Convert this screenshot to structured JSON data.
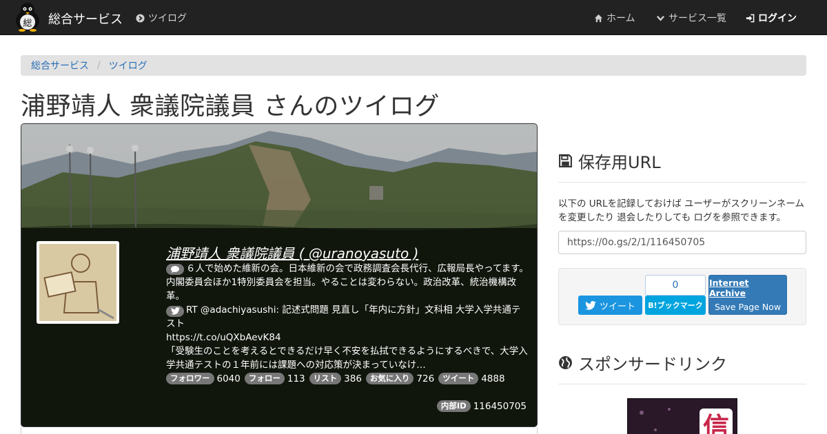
{
  "navbar": {
    "brand": "総合サービス",
    "brand_logo_char": "総",
    "service_link": "ツイログ",
    "home": "ホーム",
    "services": "サービス一覧",
    "login": "ログイン"
  },
  "breadcrumb": {
    "items": [
      "総合サービス",
      "ツイログ"
    ],
    "separator": "/"
  },
  "page_title": "浦野靖人 衆議院議員 さんのツイログ",
  "profile": {
    "display": "浦野靖人 衆議院議員 ( @uranoyasuto )",
    "bio": "６人で始めた維新の会。日本維新の会で政務調査会長代行、広報局長やってます。内閣委員会ほか1特別委員会を担当。やることは変わらない。政治改革、統治機構改革。",
    "tweet_line1": "RT @adachiyasushi: 記述式問題 見直し「年内に方針」文科相 大学入学共通テスト",
    "tweet_link": "https://t.co/uQXbAevK84",
    "tweet_line2": "「受験生のことを考えるとできるだけ早く不安を払拭できるようにするべきで、大学入学共通テストの１年前には課題への対応策が決まっていなけ…",
    "stats": [
      {
        "label": "フォロワー",
        "value": "6040"
      },
      {
        "label": "フォロー",
        "value": "113"
      },
      {
        "label": "リスト",
        "value": "386"
      },
      {
        "label": "お気に入り",
        "value": "726"
      },
      {
        "label": "ツイート",
        "value": "4888"
      }
    ],
    "internal_id_label": "内部ID",
    "internal_id": "116450705"
  },
  "sidebar": {
    "save_url_heading": "保存用URL",
    "save_url_desc": "以下の URLを記録しておけば ユーザーがスクリーンネームを変更したり 退会したりしても ログを参照できます。",
    "save_url": "https://0o.gs/2/1/116450705",
    "tweet_button": "ツイート",
    "hatena_count": "0",
    "hatena_button": "ブックマーク",
    "hatena_b": "B!",
    "ia_title": "Internet Archive",
    "ia_sub": "Save Page Now",
    "sponsor_heading": "スポンサードリンク",
    "ad_char": "信"
  },
  "colors": {
    "navbar_bg": "#222222",
    "link": "#2a6fb7",
    "badge": "#777777",
    "twitter": "#1b95e0",
    "hatena": "#00a4de",
    "primary": "#337ab7"
  }
}
